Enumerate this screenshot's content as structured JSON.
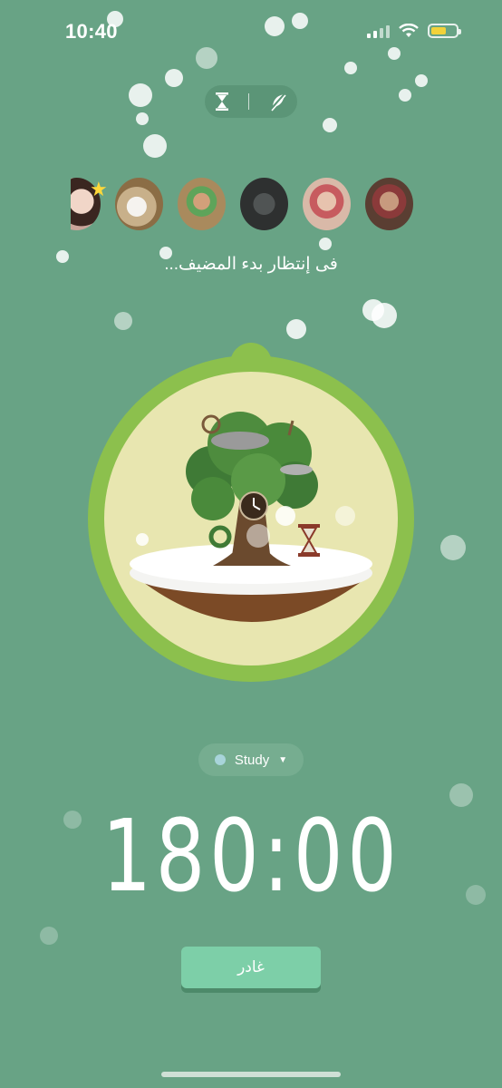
{
  "status_bar": {
    "time": "10:40",
    "battery_color": "#f2d23a"
  },
  "mode_toggle": {
    "left_icon": "hourglass-icon",
    "right_icon": "no-plant-icon"
  },
  "participants": [
    {
      "name": "avatar-1",
      "color": "#c9a59a",
      "has_star": true
    },
    {
      "name": "avatar-2",
      "color": "#c8b08a"
    },
    {
      "name": "avatar-3",
      "color": "#a98a5d"
    },
    {
      "name": "avatar-4",
      "color": "#2e3030"
    },
    {
      "name": "avatar-5",
      "color": "#d9b9a8"
    },
    {
      "name": "avatar-6",
      "color": "#5a3e32"
    }
  ],
  "waiting_text": "فى إنتظار بدء المضيف...",
  "tag": {
    "label": "Study",
    "color": "#a8d4da"
  },
  "timer": {
    "value": "180:00"
  },
  "give_up_button": {
    "label": "غادر"
  },
  "colors": {
    "background": "#68a385",
    "ring": "#8cc04d",
    "circle_fill": "#e8e6b0",
    "button": "#7dcfa8"
  }
}
